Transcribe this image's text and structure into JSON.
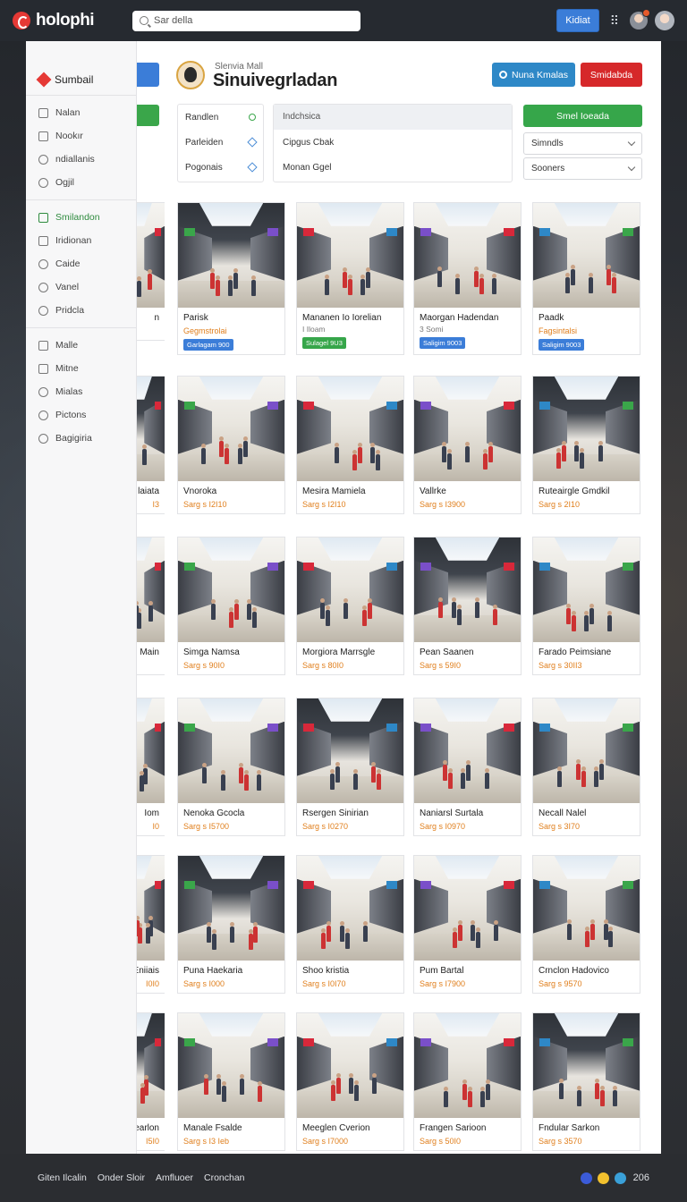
{
  "app": {
    "name": "holophi"
  },
  "search": {
    "value": "Sar della"
  },
  "topbar": {
    "button_label": "Kidiat"
  },
  "sidebar": {
    "title": "Sumbail",
    "groups": [
      [
        {
          "label": "Nalan"
        },
        {
          "label": "Nookır"
        },
        {
          "label": "ndiallanis"
        },
        {
          "label": "Ogjil"
        }
      ],
      [
        {
          "label": "Smilandon",
          "active": true
        },
        {
          "label": "Iridionan"
        },
        {
          "label": "Caide"
        },
        {
          "label": "Vanel"
        },
        {
          "label": "Pridcla"
        }
      ],
      [
        {
          "label": "Malle"
        },
        {
          "label": "Mitne"
        },
        {
          "label": "Mialas"
        },
        {
          "label": "Pictons"
        },
        {
          "label": "Bagigiria"
        }
      ]
    ]
  },
  "header": {
    "subtitle": "Slenvia Mall",
    "title": "Sinuivegrladan",
    "button_primary": "Nuna Kmalas",
    "button_danger": "Smidabda"
  },
  "filters": {
    "left_rows": [
      "Randlen",
      "Parleiden",
      "Pogonais"
    ],
    "center_head": "Indchsica",
    "center_rows": [
      "Cipgus Cbak",
      "Monan Ggel"
    ],
    "green_button": "Smel Ioeada",
    "select_1": "Simndls",
    "select_2": "Sooners"
  },
  "colors": {
    "accent_green": "#36a64a",
    "accent_blue": "#2e88c7",
    "accent_red": "#d6282a",
    "price_orange": "#e07f1d"
  },
  "grid": {
    "rows": [
      {
        "partial": {
          "title": "n",
          "price": ""
        },
        "cards": [
          {
            "title": "Parisk",
            "price": "Gegmstrolai",
            "tag": "Garlagam 900",
            "tag_color": "#3b7dd8"
          },
          {
            "title": "Mananen Io Iorelian",
            "meta": "I Iloam",
            "tag": "Sulagel 9U3",
            "tag_color": "#36a64a"
          },
          {
            "title": "Maorgan Hadendan",
            "meta": "3 Somi",
            "tag": "Saligim 9003",
            "tag_color": "#3b7dd8"
          },
          {
            "title": "Paadk",
            "price": "Fagsintalsi",
            "tag": "Saligim 9003",
            "tag_color": "#3b7dd8"
          }
        ]
      },
      {
        "partial": {
          "title": "laiata",
          "price": "I3"
        },
        "cards": [
          {
            "title": "Vnoroka",
            "price": "Sarg s I2I10"
          },
          {
            "title": "Mesira Mamiela",
            "price": "Sarg s I2I10"
          },
          {
            "title": "Vallrke",
            "price": "Sarg s I3900"
          },
          {
            "title": "Ruteairgle Gmdkil",
            "price": "Sarg s 2I10"
          }
        ]
      },
      {
        "partial": {
          "title": "Main",
          "price": ""
        },
        "cards": [
          {
            "title": "Simga Namsa",
            "price": "Sarg s 90I0"
          },
          {
            "title": "Morgiora Marrsgle",
            "price": "Sarg s 80I0"
          },
          {
            "title": "Pean Saanen",
            "price": "Sarg s 59I0"
          },
          {
            "title": "Farado Peimsiane",
            "price": "Sarg s 30II3"
          }
        ]
      },
      {
        "partial": {
          "title": "Iom",
          "price": "I0"
        },
        "cards": [
          {
            "title": "Nenoka Gcocla",
            "price": "Sarg s I5700"
          },
          {
            "title": "Rsergen Sinirian",
            "price": "Sarg s I0270"
          },
          {
            "title": "Naniarsl Surtala",
            "price": "Sarg s I0970"
          },
          {
            "title": "Necall Nalel",
            "price": "Sarg s 3I70"
          }
        ]
      },
      {
        "partial": {
          "title": "Eniiais",
          "price": "I0I0"
        },
        "cards": [
          {
            "title": "Puna Haekaria",
            "price": "Sarg s I000"
          },
          {
            "title": "Shoo kristia",
            "price": "Sarg s I0I70"
          },
          {
            "title": "Pum Bartal",
            "price": "Sarg s I7900"
          },
          {
            "title": "Crnclon Hadovico",
            "price": "Sarg s 9570"
          }
        ]
      },
      {
        "partial": {
          "title": "Vearlon",
          "price": "I5I0"
        },
        "cards": [
          {
            "title": "Manale Fsalde",
            "price": "Sarg s I3 Ieb"
          },
          {
            "title": "Meeglen Cverion",
            "price": "Sarg s I7000"
          },
          {
            "title": "Frangen Sarioon",
            "price": "Sarg s 50I0"
          },
          {
            "title": "Fndular Sarkon",
            "price": "Sarg s 3570"
          }
        ]
      }
    ]
  },
  "footer": {
    "links": [
      "Giten Ilcalin",
      "Onder Sloir",
      "Amfluoer",
      "Cronchan"
    ],
    "count": "206"
  }
}
